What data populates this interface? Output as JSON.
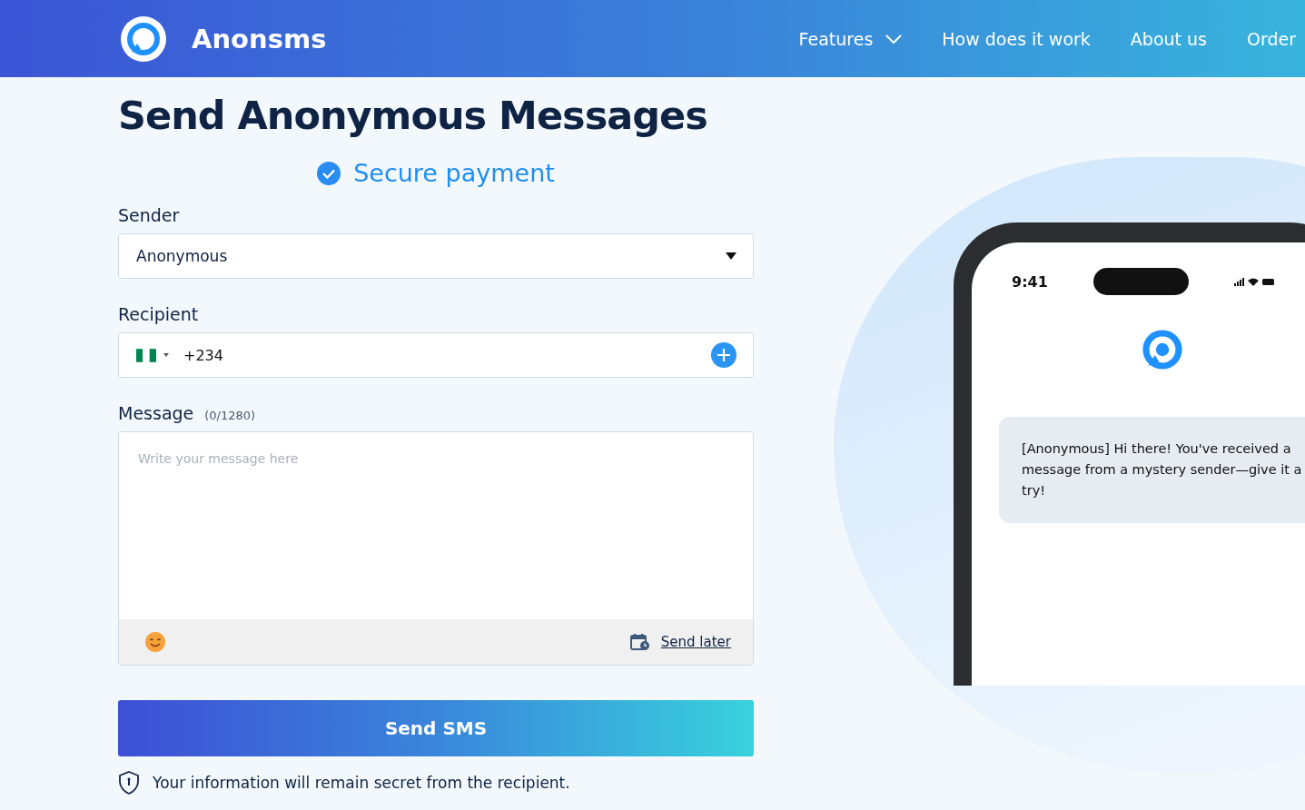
{
  "header": {
    "brand": "Anonsms",
    "nav": [
      {
        "label": "Features",
        "kind": "dropdown"
      },
      {
        "label": "How does it work",
        "kind": "link"
      },
      {
        "label": "About us",
        "kind": "link"
      },
      {
        "label": "Order",
        "kind": "link"
      }
    ]
  },
  "form": {
    "title": "Send Anonymous Messages",
    "secure_note": "Secure payment",
    "sender": {
      "label": "Sender",
      "value": "Anonymous"
    },
    "recipient": {
      "label": "Recipient",
      "value": "+234"
    },
    "message": {
      "label": "Message",
      "counter": "(0/1280)",
      "placeholder": "Write your message here",
      "send_later": "Send later"
    },
    "submit": "Send SMS",
    "privacy_note": "Your information will remain secret from the recipient."
  },
  "phone": {
    "time": "9:41",
    "message": "[Anonymous] Hi there! You've received a message from a mystery sender—give it a try!"
  }
}
